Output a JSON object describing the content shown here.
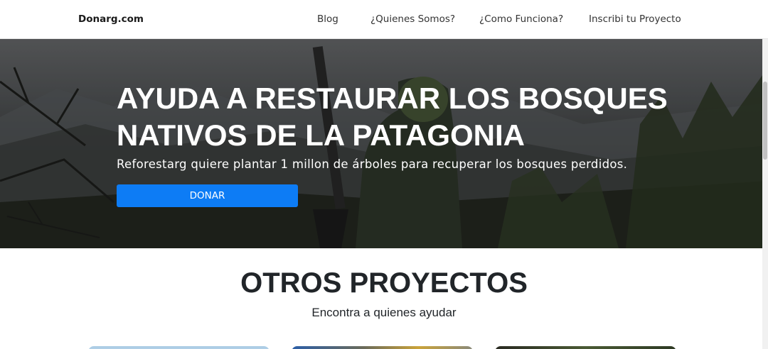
{
  "navbar": {
    "brand": "Donarg.com",
    "links": [
      {
        "label": "Blog"
      },
      {
        "label": "¿Quienes Somos?"
      },
      {
        "label": "¿Como Funciona?"
      },
      {
        "label": "Inscribi tu Proyecto"
      }
    ]
  },
  "hero": {
    "title": "AYUDA A RESTAURAR LOS BOSQUES NATIVOS DE LA PATAGONIA",
    "subtitle": "Reforestarg quiere plantar 1 millon de árboles para recuperar los bosques perdidos.",
    "button_label": "DONAR",
    "button_color": "#0d7cf5"
  },
  "projects": {
    "title": "OTROS PROYECTOS",
    "subtitle": "Encontra a quienes ayudar"
  }
}
